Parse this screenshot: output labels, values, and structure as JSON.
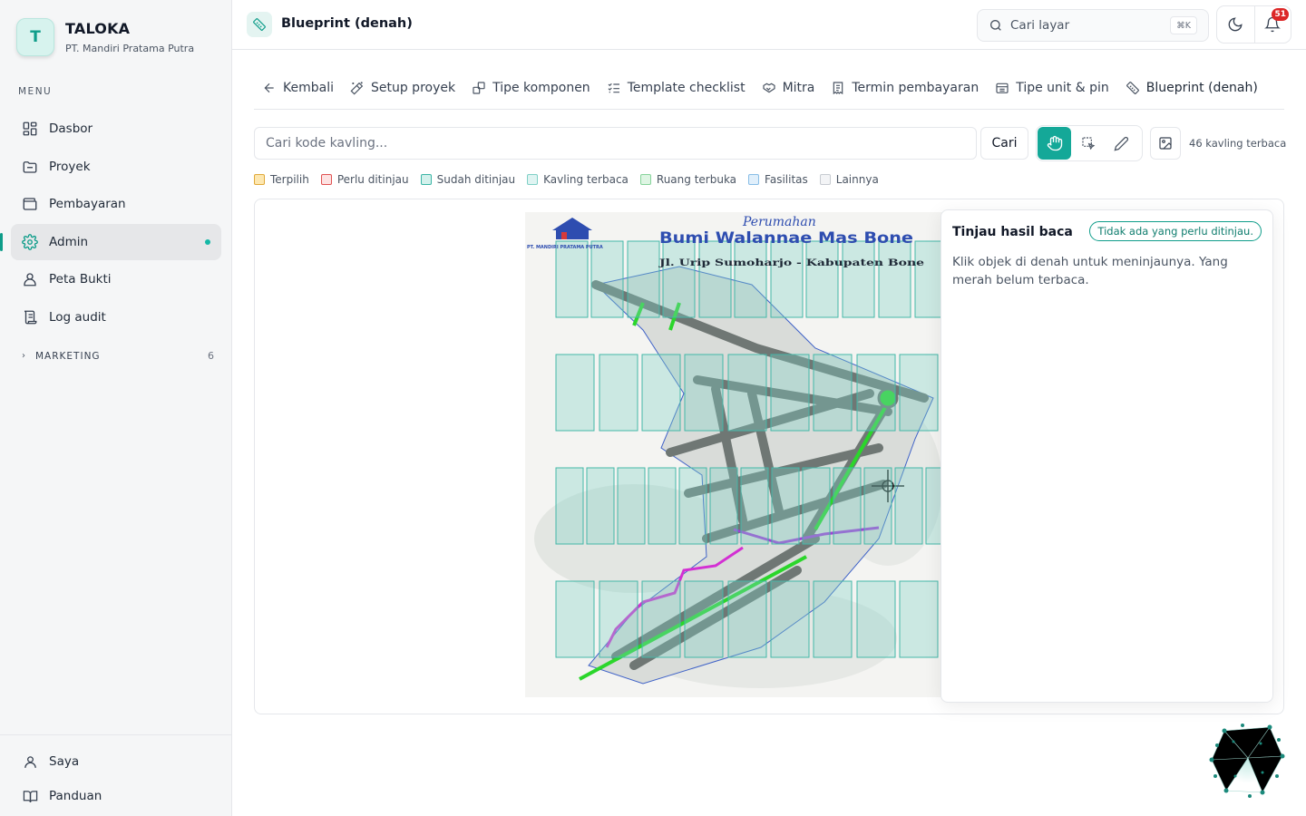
{
  "app": {
    "name": "TALOKA",
    "company": "PT. Mandiri Pratama Putra",
    "logo_letter": "T"
  },
  "sidebar": {
    "menu_title": "MENU",
    "items": [
      {
        "label": "Dasbor",
        "icon": "dashboard-icon"
      },
      {
        "label": "Proyek",
        "icon": "folder-icon"
      },
      {
        "label": "Pembayaran",
        "icon": "wallet-icon"
      },
      {
        "label": "Admin",
        "icon": "gear-icon",
        "active": true
      },
      {
        "label": "Peta Bukti",
        "icon": "user-pin-icon"
      },
      {
        "label": "Log audit",
        "icon": "scroll-icon"
      }
    ],
    "section": {
      "label": "MARKETING",
      "count": "6"
    },
    "bottom": [
      {
        "label": "Saya",
        "icon": "user-icon"
      },
      {
        "label": "Panduan",
        "icon": "book-icon"
      }
    ]
  },
  "header": {
    "title": "Blueprint (denah)",
    "search_label": "Cari layar",
    "shortcut": "⌘K",
    "notification_count": "51"
  },
  "tabs": [
    {
      "label": "Kembali",
      "icon": "arrow-left-icon"
    },
    {
      "label": "Setup proyek",
      "icon": "wand-icon"
    },
    {
      "label": "Tipe komponen",
      "icon": "blocks-icon"
    },
    {
      "label": "Template checklist",
      "icon": "checklist-icon"
    },
    {
      "label": "Mitra",
      "icon": "handshake-icon"
    },
    {
      "label": "Termin pembayaran",
      "icon": "receipt-icon"
    },
    {
      "label": "Tipe unit & pin",
      "icon": "layers-icon"
    },
    {
      "label": "Blueprint (denah)",
      "icon": "ruler-icon",
      "active": true
    }
  ],
  "toolbar": {
    "search_placeholder": "Cari kode kavling...",
    "search_button": "Cari",
    "read_count": "46 kavling terbaca"
  },
  "legend": [
    {
      "label": "Terpilih",
      "fill": "#fde7b0",
      "border": "#e0a93a"
    },
    {
      "label": "Perlu ditinjau",
      "fill": "#fde2e2",
      "border": "#e05252"
    },
    {
      "label": "Sudah ditinjau",
      "fill": "#d3f1ec",
      "border": "#3bb5a5"
    },
    {
      "label": "Kavling terbaca",
      "fill": "#dff4f2",
      "border": "#7fd0c6"
    },
    {
      "label": "Ruang terbuka",
      "fill": "#def5e3",
      "border": "#86d39a"
    },
    {
      "label": "Fasilitas",
      "fill": "#e0effb",
      "border": "#88bde6"
    },
    {
      "label": "Lainnya",
      "fill": "#f3f4f6",
      "border": "#c7cbd1"
    }
  ],
  "blueprint": {
    "script_title": "Perumahan",
    "title": "Bumi Walannae Mas Bone",
    "address": "Jl. Urip Sumoharjo - Kabupaten Bone",
    "company": "PT. MANDIRI PRATAMA PUTRA"
  },
  "review_panel": {
    "title": "Tinjau hasil baca",
    "status": "Tidak ada yang perlu ditinjau.",
    "body": "Klik objek di denah untuk meninjaunya. Yang merah belum terbaca."
  },
  "colors": {
    "accent": "#14a898",
    "badge_red": "#dc2626"
  }
}
